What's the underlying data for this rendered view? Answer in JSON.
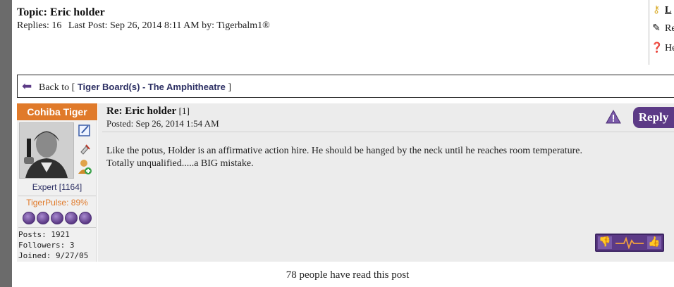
{
  "topic": {
    "title": "Topic: Eric holder",
    "replies": "Replies: 16",
    "last_post": "Last Post: Sep 26, 2014 8:11 AM by: Tigerbalm1®"
  },
  "quicklinks": [
    {
      "label": "L",
      "icon": "key-icon"
    },
    {
      "label": "Re",
      "icon": "reply-doc-icon"
    },
    {
      "label": "He",
      "icon": "help-icon"
    }
  ],
  "back": {
    "prefix": "Back to [",
    "board": "Tiger Board(s)",
    "dash": "-",
    "section": "The Amphitheatre",
    "suffix": "]"
  },
  "post": {
    "user": {
      "name": "Cohiba Tiger",
      "rank": "Expert [1164]",
      "pulse": "TigerPulse: 89%",
      "pulse_orbs": 5,
      "posts": "Posts: 1921",
      "followers": "Followers: 3",
      "joined": "Joined: 9/27/05"
    },
    "title": "Re: Eric holder",
    "title_num": "[1]",
    "posted": "Posted: Sep 26, 2014 1:54 AM",
    "reply_label": "Reply",
    "body_line1": "Like the potus, Holder is an affirmative action hire. He should be hanged by the neck until he reaches room temperature.",
    "body_line2": "Totally unqualified.....a BIG mistake."
  },
  "reads": "78 people have read this post",
  "colors": {
    "accent_purple": "#5c3a86",
    "username_orange": "#e07a2a",
    "link_navy": "#2c2f63"
  }
}
